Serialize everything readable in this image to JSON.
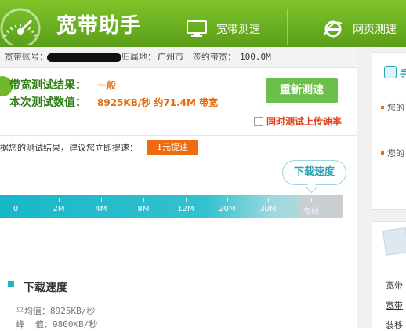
{
  "header": {
    "app_title": "宽带助手",
    "nav": [
      {
        "label": "宽带测速",
        "icon": "monitor-icon"
      },
      {
        "label": "网页测速",
        "icon": "ie-browser-icon"
      }
    ]
  },
  "info": {
    "account_label": "宽带账号：",
    "location_label": "归属地：",
    "location_value": "广州市",
    "contract_label": "签约带宽：",
    "contract_value": "100.0M"
  },
  "result": {
    "test_result_label": "带宽测试结果：",
    "test_result_value": "一般",
    "speed_label": "本次测试数值：",
    "speed_value": "8925KB/秒 约71.4M 带宽",
    "retest_button": "重新测速",
    "upload_checkbox_label": "同时测试上传速率"
  },
  "tip": {
    "text": "据您的测试结果，建议您立即提速：",
    "boost_button": "1元提速"
  },
  "gauge": {
    "bubble": "下载速度",
    "scale": [
      "0",
      "2M",
      "4M",
      "8M",
      "12M",
      "20M",
      "30M",
      "专线"
    ],
    "colors": {
      "fill": "#18b7c8",
      "end": "#c9cfd1"
    }
  },
  "download": {
    "title": "下载速度",
    "avg_label": "平均值：",
    "avg_value": "8925KB/秒",
    "peak_label": "峰    值：",
    "peak_value": "9800KB/秒"
  },
  "right_panel": {
    "card1_title": "手",
    "items": [
      "您的",
      "您的"
    ],
    "links": [
      "宽带",
      "宽带",
      "装移"
    ]
  },
  "colors": {
    "header_green": "#6ab423",
    "label_green": "#2f7d15",
    "value_orange": "#e86a0b",
    "accent_teal": "#18b7c8",
    "boost_orange": "#f06a10"
  }
}
